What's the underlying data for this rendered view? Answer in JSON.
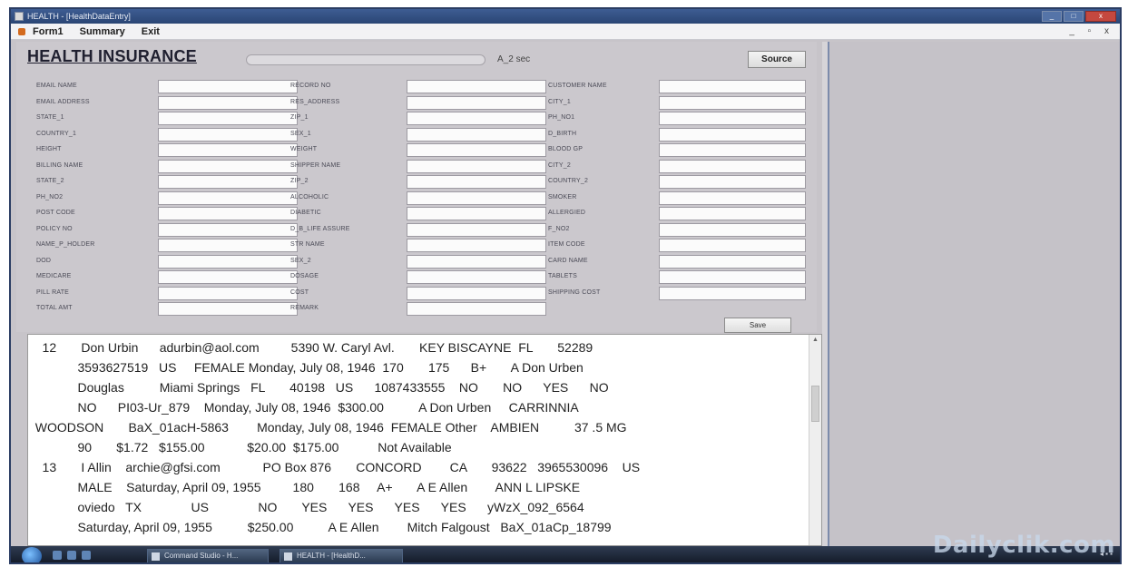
{
  "window": {
    "title": "HEALTH - [HealthDataEntry]",
    "controls": [
      "_",
      "□",
      "x"
    ]
  },
  "menu": {
    "items": [
      "Form1",
      "Summary",
      "Exit"
    ],
    "mdi_controls": "_ ▫ x"
  },
  "form": {
    "title": "HEALTH INSURANCE",
    "status_text": "A_2 sec",
    "source_label": "Source",
    "save_label": "Save",
    "col1_labels": [
      "EMAIL NAME",
      "EMAIL ADDRESS",
      "STATE_1",
      "COUNTRY_1",
      "HEIGHT",
      "BILLING NAME",
      "STATE_2",
      "PH_NO2",
      "POST CODE",
      "POLICY NO",
      "NAME_P_HOLDER",
      "DOD",
      "MEDICARE",
      "PILL RATE",
      "TOTAL AMT"
    ],
    "col2_labels": [
      "RECORD NO",
      "RES_ADDRESS",
      "ZIP_1",
      "SEX_1",
      "WEIGHT",
      "SHIPPER NAME",
      "ZIP_2",
      "ALCOHOLIC",
      "DIABETIC",
      "D_B_LIFE ASSURE",
      "STR NAME",
      "SEX_2",
      "DOSAGE",
      "COST",
      "REMARK"
    ],
    "col3_labels": [
      "CUSTOMER NAME",
      "CITY_1",
      "PH_NO1",
      "D_BIRTH",
      "BLOOD GP",
      "CITY_2",
      "COUNTRY_2",
      "SMOKER",
      "ALLERGIED",
      "F_NO2",
      "ITEM CODE",
      "CARD NAME",
      "TABLETS",
      "SHIPPING COST"
    ]
  },
  "records": [
    [
      "    12       Don Urbin      adurbin@aol.com         5390 W. Caryl Avl.       KEY BISCAYNE  FL       52289"
    ],
    [
      "              3593627519   US     FEMALE Monday, July 08, 1946  170       175      B+       A Don Urben"
    ],
    [
      "              Douglas          Miami Springs   FL       40198   US      1087433555    NO       NO      YES      NO"
    ],
    [
      "              NO      PI03-Ur_879    Monday, July 08, 1946  $300.00          A Don Urben     CARRINNIA"
    ],
    [
      "  WOODSON       BaX_01acH-5863        Monday, July 08, 1946  FEMALE Other    AMBIEN          37 .5 MG"
    ],
    [
      "              90       $1.72   $155.00            $20.00  $175.00           Not Available"
    ],
    [
      "    13       I Allin    archie@gfsi.com            PO Box 876       CONCORD        CA       93622   3965530096    US"
    ],
    [
      "              MALE    Saturday, April 09, 1955         180       168     A+       A E Allen        ANN L LIPSKE"
    ],
    [
      "              oviedo   TX              US              NO       YES      YES      YES      YES      yWzX_092_6564"
    ],
    [
      "              Saturday, April 09, 1955          $250.00          A E Allen        Mitch Falgoust   BaX_01aCp_18799"
    ]
  ],
  "taskbar": {
    "tasks": [
      "Command Studio - H...",
      "HEALTH - [HealthD..."
    ]
  },
  "watermark": "Dailyclik.com"
}
